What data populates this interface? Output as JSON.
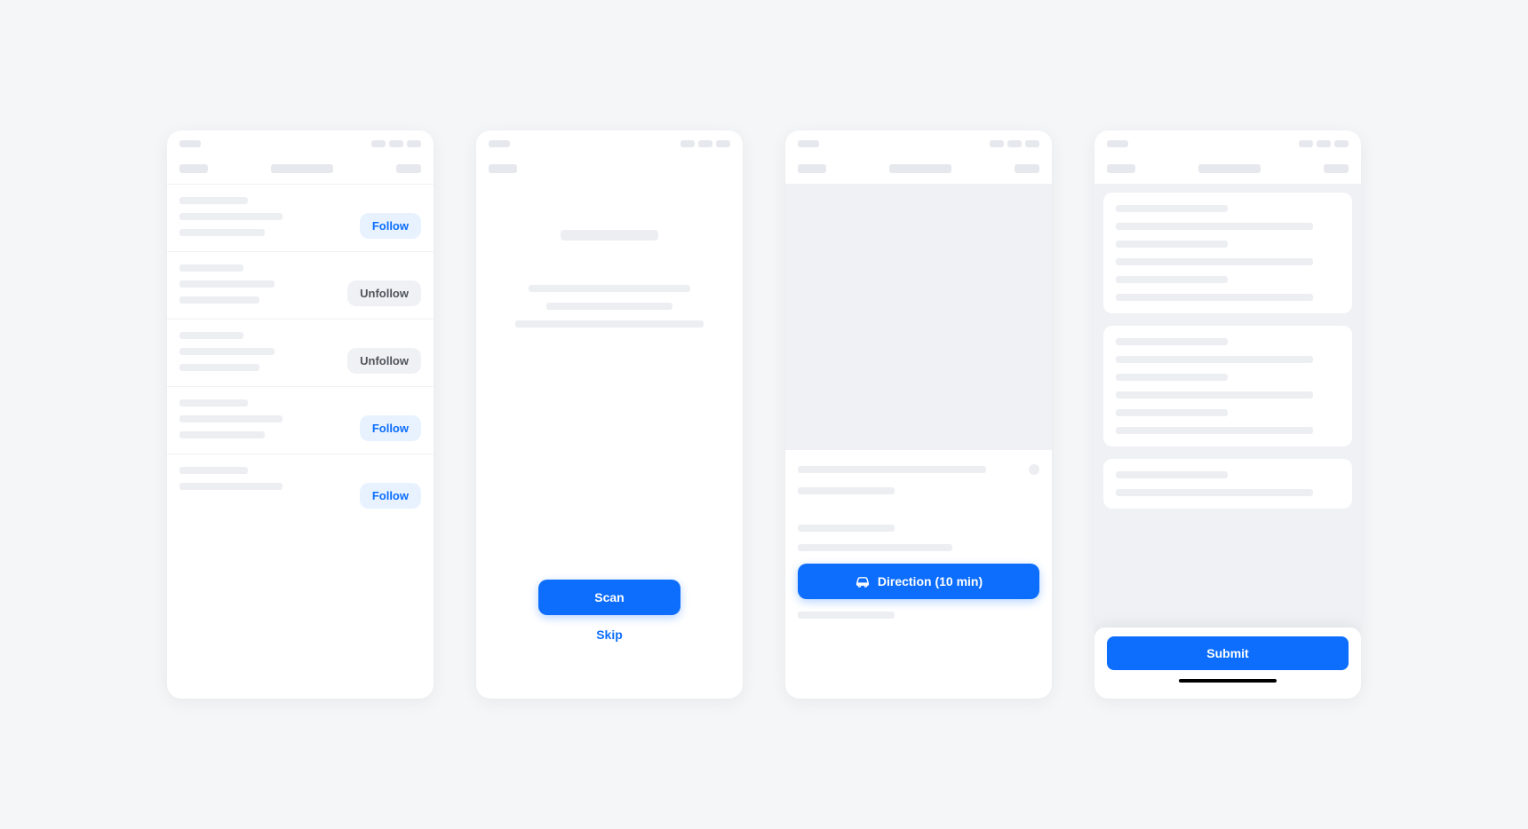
{
  "colors": {
    "primary": "#0d6efd",
    "follow_bg": "#e8f2ff",
    "unfollow_bg": "#f0f1f4"
  },
  "phone1": {
    "items": [
      {
        "action": "follow",
        "label": "Follow"
      },
      {
        "action": "unfollow",
        "label": "Unfollow"
      },
      {
        "action": "unfollow",
        "label": "Unfollow"
      },
      {
        "action": "follow",
        "label": "Follow"
      },
      {
        "action": "follow",
        "label": "Follow"
      }
    ]
  },
  "phone2": {
    "scan_label": "Scan",
    "skip_label": "Skip"
  },
  "phone3": {
    "direction_label": "Direction (10 min)",
    "car_icon": "car-icon"
  },
  "phone4": {
    "submit_label": "Submit"
  }
}
